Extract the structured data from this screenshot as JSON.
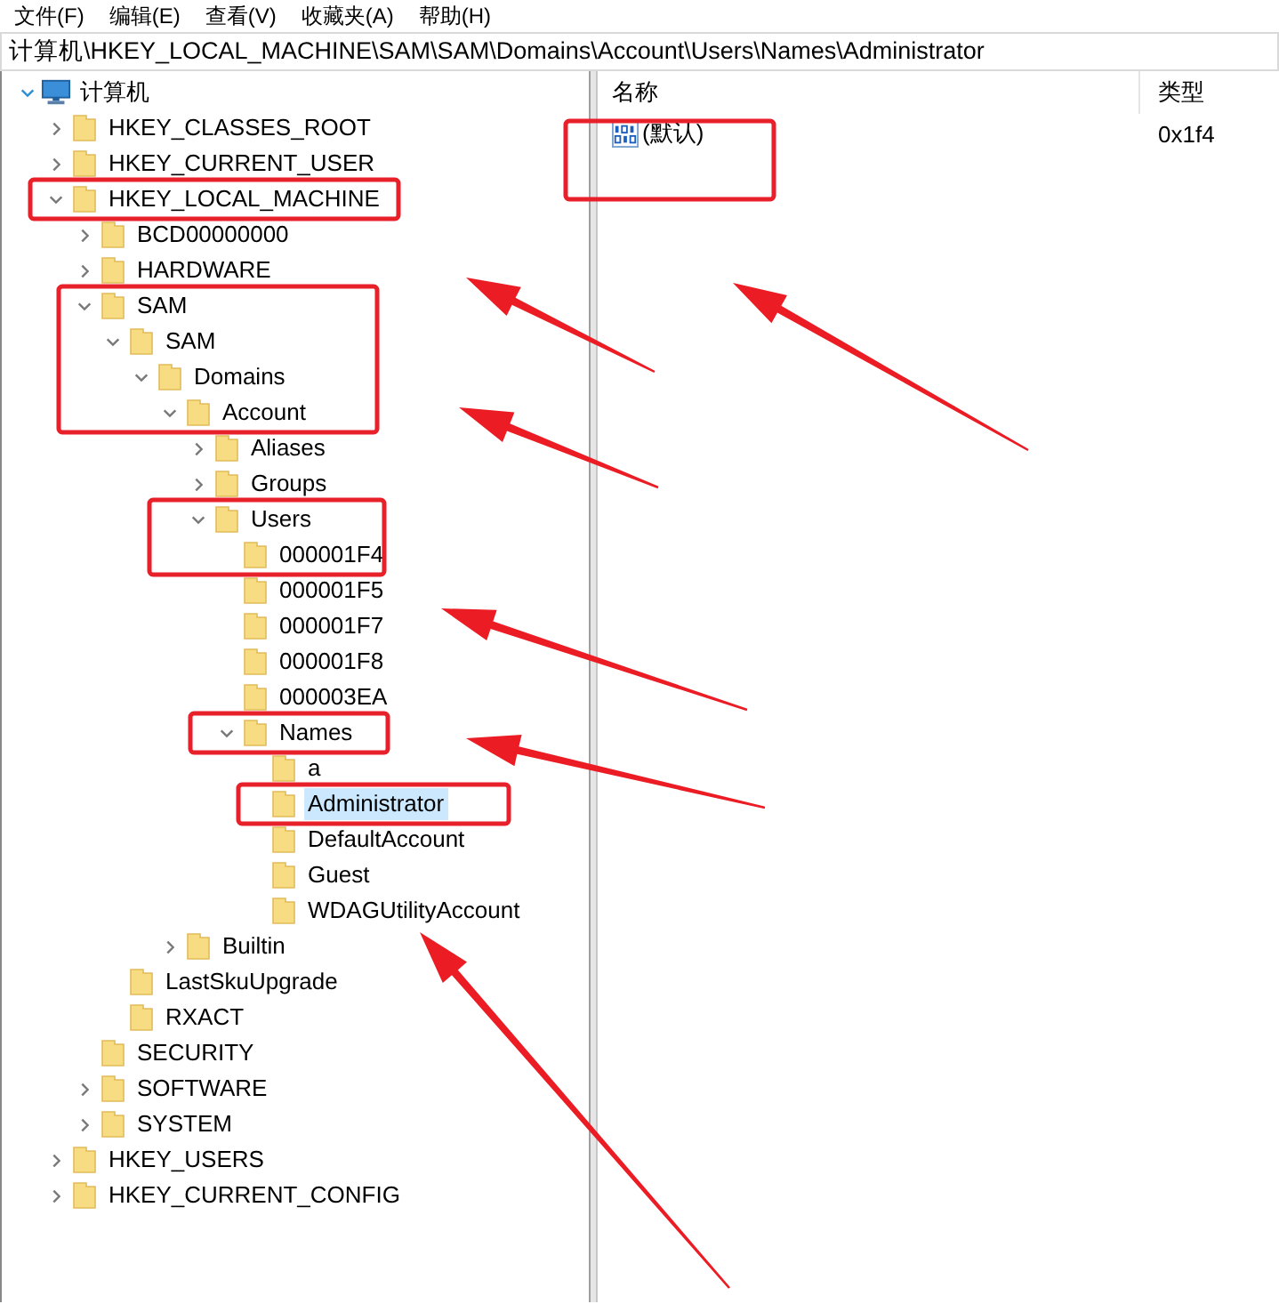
{
  "menu": [
    "文件(F)",
    "编辑(E)",
    "查看(V)",
    "收藏夹(A)",
    "帮助(H)"
  ],
  "address": "计算机\\HKEY_LOCAL_MACHINE\\SAM\\SAM\\Domains\\Account\\Users\\Names\\Administrator",
  "tree": [
    {
      "label": "计算机",
      "kind": "computer",
      "expanded": true,
      "selected": false,
      "children": [
        {
          "label": "HKEY_CLASSES_ROOT",
          "expanded": false,
          "selected": false
        },
        {
          "label": "HKEY_CURRENT_USER",
          "expanded": false,
          "selected": false
        },
        {
          "label": "HKEY_LOCAL_MACHINE",
          "expanded": true,
          "selected": false,
          "children": [
            {
              "label": "BCD00000000",
              "expanded": false,
              "selected": false
            },
            {
              "label": "HARDWARE",
              "expanded": false,
              "selected": false
            },
            {
              "label": "SAM",
              "expanded": true,
              "selected": false,
              "children": [
                {
                  "label": "SAM",
                  "expanded": true,
                  "selected": false,
                  "children": [
                    {
                      "label": "Domains",
                      "expanded": true,
                      "selected": false,
                      "children": [
                        {
                          "label": "Account",
                          "expanded": true,
                          "selected": false,
                          "children": [
                            {
                              "label": "Aliases",
                              "expanded": false,
                              "selected": false
                            },
                            {
                              "label": "Groups",
                              "expanded": false,
                              "selected": false
                            },
                            {
                              "label": "Users",
                              "expanded": true,
                              "selected": false,
                              "children": [
                                {
                                  "label": "000001F4",
                                  "selected": false
                                },
                                {
                                  "label": "000001F5",
                                  "selected": false
                                },
                                {
                                  "label": "000001F7",
                                  "selected": false
                                },
                                {
                                  "label": "000001F8",
                                  "selected": false
                                },
                                {
                                  "label": "000003EA",
                                  "selected": false
                                },
                                {
                                  "label": "Names",
                                  "expanded": true,
                                  "selected": false,
                                  "children": [
                                    {
                                      "label": "a",
                                      "selected": false
                                    },
                                    {
                                      "label": "Administrator",
                                      "selected": true
                                    },
                                    {
                                      "label": "DefaultAccount",
                                      "selected": false
                                    },
                                    {
                                      "label": "Guest",
                                      "selected": false
                                    },
                                    {
                                      "label": "WDAGUtilityAccount",
                                      "selected": false
                                    }
                                  ]
                                }
                              ]
                            }
                          ]
                        },
                        {
                          "label": "Builtin",
                          "expanded": false,
                          "selected": false
                        }
                      ]
                    }
                  ]
                },
                {
                  "label": "LastSkuUpgrade",
                  "selected": false
                },
                {
                  "label": "RXACT",
                  "selected": false
                }
              ]
            },
            {
              "label": "SECURITY",
              "selected": false
            },
            {
              "label": "SOFTWARE",
              "expanded": false,
              "selected": false
            },
            {
              "label": "SYSTEM",
              "expanded": false,
              "selected": false
            }
          ]
        },
        {
          "label": "HKEY_USERS",
          "expanded": false,
          "selected": false
        },
        {
          "label": "HKEY_CURRENT_CONFIG",
          "expanded": false,
          "selected": false
        }
      ]
    }
  ],
  "values": {
    "columns": [
      "名称",
      "类型"
    ],
    "rows": [
      {
        "name": "(默认)",
        "type": "0x1f4"
      }
    ]
  }
}
